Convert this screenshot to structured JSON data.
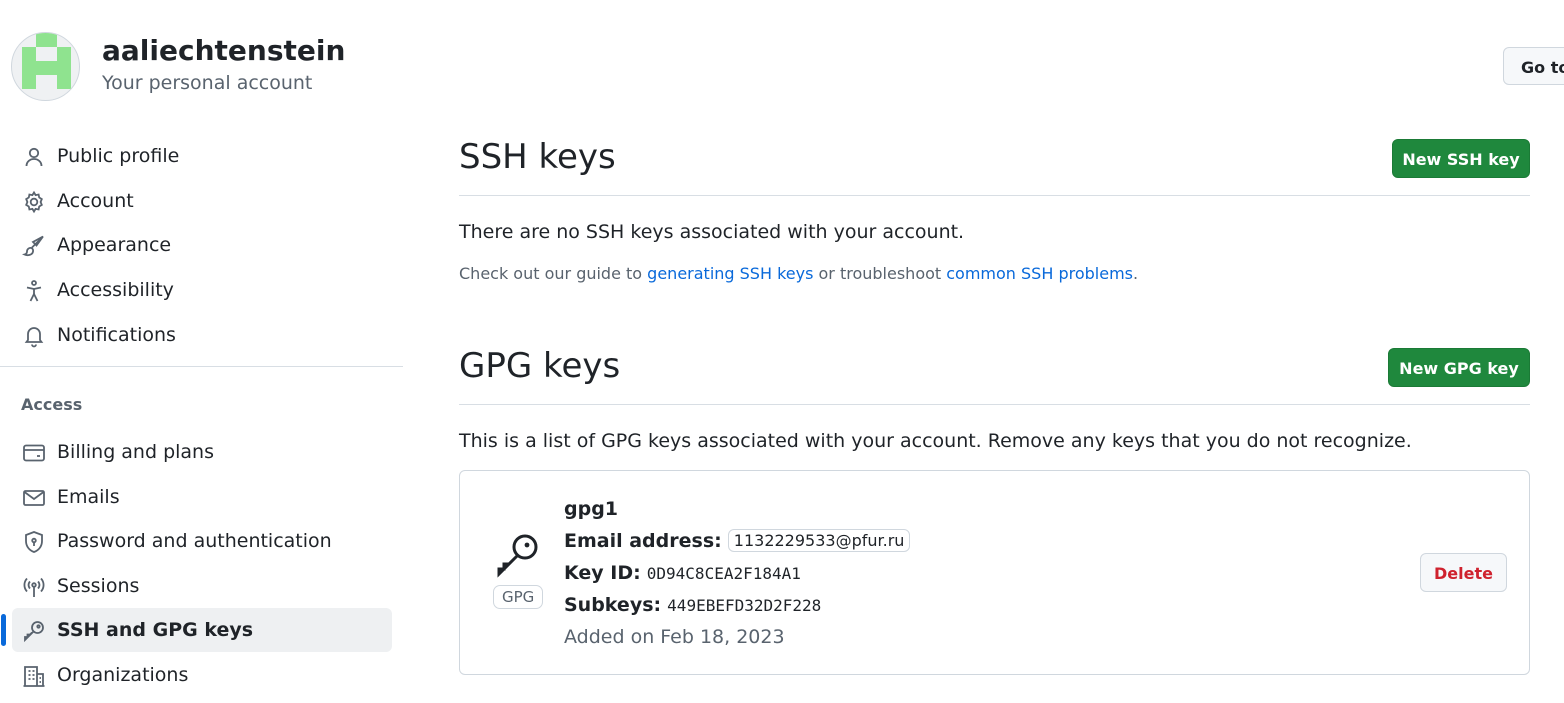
{
  "account": {
    "username": "aaliechtenstein",
    "subtitle": "Your personal account",
    "goto_button": "Go to your personal profile"
  },
  "sidebar": {
    "items": [
      {
        "label": "Public profile",
        "icon": "person-icon"
      },
      {
        "label": "Account",
        "icon": "gear-icon"
      },
      {
        "label": "Appearance",
        "icon": "paintbrush-icon"
      },
      {
        "label": "Accessibility",
        "icon": "accessibility-icon"
      },
      {
        "label": "Notifications",
        "icon": "bell-icon"
      }
    ],
    "access_heading": "Access",
    "access_items": [
      {
        "label": "Billing and plans",
        "icon": "credit-card-icon"
      },
      {
        "label": "Emails",
        "icon": "mail-icon"
      },
      {
        "label": "Password and authentication",
        "icon": "shield-lock-icon"
      },
      {
        "label": "Sessions",
        "icon": "broadcast-icon"
      },
      {
        "label": "SSH and GPG keys",
        "icon": "key-icon",
        "active": true
      },
      {
        "label": "Organizations",
        "icon": "organization-icon"
      }
    ]
  },
  "ssh": {
    "title": "SSH keys",
    "new_button": "New SSH key",
    "empty_text": "There are no SSH keys associated with your account.",
    "help_prefix": "Check out our guide to ",
    "help_link1": "generating SSH keys",
    "help_middle": " or troubleshoot ",
    "help_link2": "common SSH problems",
    "help_suffix": "."
  },
  "gpg": {
    "title": "GPG keys",
    "new_button": "New GPG key",
    "description": "This is a list of GPG keys associated with your account. Remove any keys that you do not recognize.",
    "keys": [
      {
        "badge": "GPG",
        "name": "gpg1",
        "email_label": "Email address:",
        "email": "1132229533@pfur.ru",
        "keyid_label": "Key ID:",
        "keyid": "0D94C8CEA2F184A1",
        "subkeys_label": "Subkeys:",
        "subkeys": "449EBEFD32D2F228",
        "added": "Added on Feb 18, 2023",
        "delete_button": "Delete"
      }
    ]
  },
  "colors": {
    "primary_button": "#1f883d",
    "link": "#0969da",
    "danger": "#cf222e",
    "active_marker": "#0969da",
    "avatar_green": "#8fe38f"
  }
}
